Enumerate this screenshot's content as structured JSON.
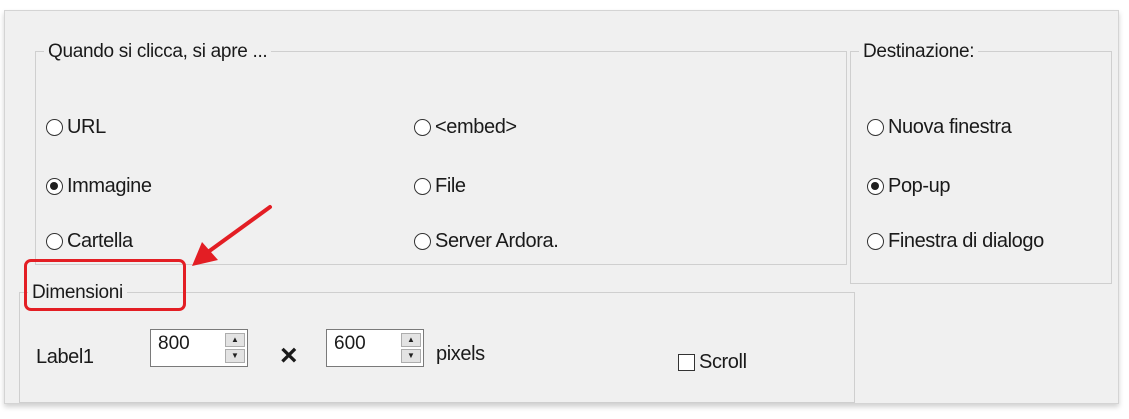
{
  "open_group": {
    "title": "Quando si clicca, si apre ...",
    "options": [
      {
        "label": "URL",
        "checked": false
      },
      {
        "label": "<embed>",
        "checked": false
      },
      {
        "label": "Immagine",
        "checked": true
      },
      {
        "label": "File",
        "checked": false
      },
      {
        "label": "Cartella",
        "checked": false
      },
      {
        "label": "Server Ardora.",
        "checked": false
      }
    ]
  },
  "destination_group": {
    "title": "Destinazione:",
    "options": [
      {
        "label": "Nuova finestra",
        "checked": false
      },
      {
        "label": "Pop-up",
        "checked": true
      },
      {
        "label": "Finestra di dialogo",
        "checked": false
      }
    ]
  },
  "dimensions_group": {
    "title": "Dimensioni",
    "row_label": "Label1",
    "width_value": "800",
    "separator": "×",
    "height_value": "600",
    "unit": "pixels",
    "scroll_label": "Scroll",
    "scroll_checked": false
  },
  "annotation": {
    "color": "#e31e24",
    "arrow_icon": "arrow-icon"
  }
}
